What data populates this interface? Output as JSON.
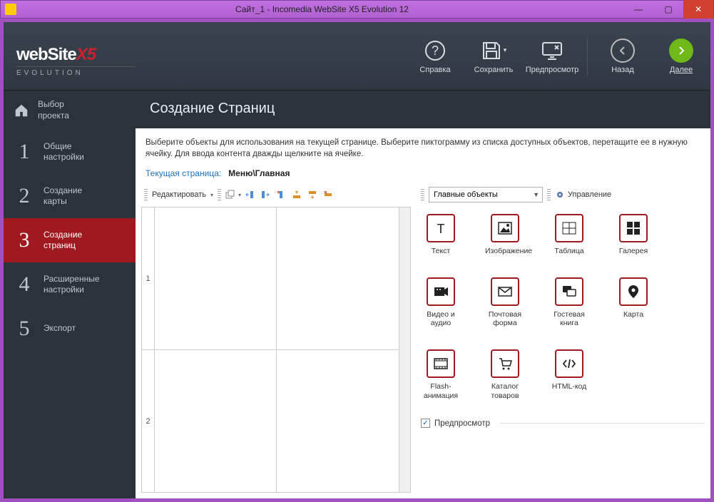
{
  "window": {
    "title": "Сайт_1 - Incomedia WebSite X5 Evolution 12"
  },
  "brand": {
    "name": "webSite",
    "suffix": "X5",
    "sub": "EVOLUTION"
  },
  "header_buttons": {
    "help": "Справка",
    "save": "Сохранить",
    "preview": "Предпросмотр",
    "back": "Назад",
    "next": "Далее"
  },
  "sidebar": [
    {
      "num": "",
      "label": "Выбор\nпроекта",
      "icon": "home"
    },
    {
      "num": "1",
      "label": "Общие\nнастройки"
    },
    {
      "num": "2",
      "label": "Создание\nкарты"
    },
    {
      "num": "3",
      "label": "Создание\nстраниц"
    },
    {
      "num": "4",
      "label": "Расширенные\nнастройки"
    },
    {
      "num": "5",
      "label": "Экспорт"
    }
  ],
  "page": {
    "title": "Создание Страниц",
    "instruction": "Выберите объекты для использования на текущей странице. Выберите пиктограмму из списка доступных объектов, перетащите ее в нужную ячейку. Для ввода контента дважды щелкните на ячейке.",
    "current_label": "Текущая страница:",
    "current_value": "Меню\\Главная"
  },
  "toolbar": {
    "edit": "Редактировать"
  },
  "grid": {
    "rows": [
      "1",
      "2"
    ]
  },
  "objects_panel": {
    "dropdown": "Главные объекты",
    "manage": "Управление",
    "items": [
      {
        "id": "text",
        "label": "Текст"
      },
      {
        "id": "image",
        "label": "Изображение"
      },
      {
        "id": "table",
        "label": "Таблица"
      },
      {
        "id": "gallery",
        "label": "Галерея"
      },
      {
        "id": "video",
        "label": "Видео и аудио"
      },
      {
        "id": "mailform",
        "label": "Почтовая форма"
      },
      {
        "id": "guestbook",
        "label": "Гостевая книга"
      },
      {
        "id": "map",
        "label": "Карта"
      },
      {
        "id": "flash",
        "label": "Flash-анимация"
      },
      {
        "id": "catalog",
        "label": "Каталог товаров"
      },
      {
        "id": "htmlcode",
        "label": "HTML-код"
      }
    ],
    "preview_checkbox": "Предпросмотр"
  }
}
